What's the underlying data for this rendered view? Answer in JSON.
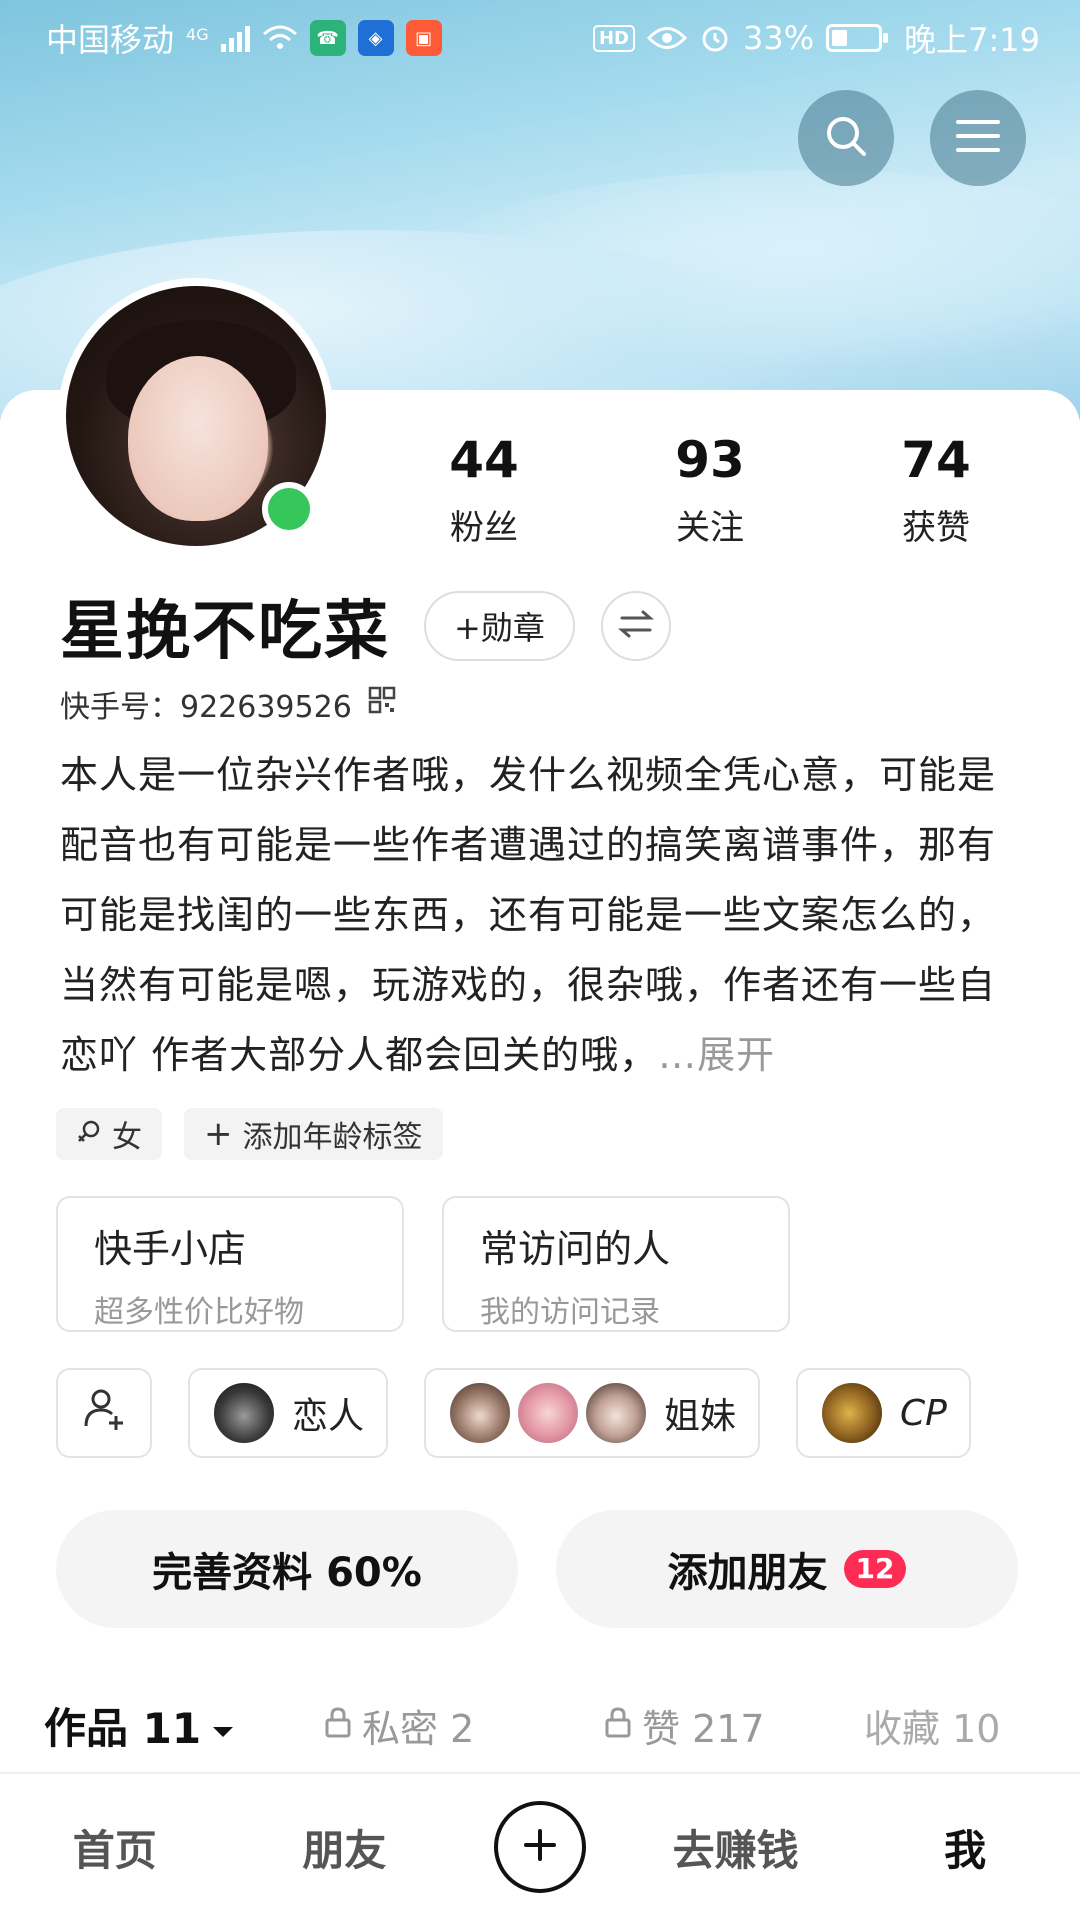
{
  "status_bar": {
    "carrier": "中国移动",
    "network": "4G",
    "battery": "33%",
    "battery_level": 0.33,
    "time": "晚上7:19",
    "hd": "HD"
  },
  "profile": {
    "nickname": "星挽不吃菜",
    "medal_label": "+勋章",
    "kuaishou_id_label": "快手号：",
    "kuaishou_id": "922639526",
    "bio": "本人是一位杂兴作者哦，发什么视频全凭心意，可能是配音也有可能是一些作者遭遇过的搞笑离谱事件，那有可能是找闺的一些东西，还有可能是一些文案怎么的，当然有可能是嗯，玩游戏的，很杂哦，作者还有一些自恋吖 作者大部分人都会回关的哦，",
    "bio_expand": "…展开",
    "online": true
  },
  "stats": [
    {
      "num": "44",
      "label": "粉丝"
    },
    {
      "num": "93",
      "label": "关注"
    },
    {
      "num": "74",
      "label": "获赞"
    }
  ],
  "tags": {
    "gender": "女",
    "add_age": "添加年龄标签"
  },
  "feature_cards": [
    {
      "title": "快手小店",
      "sub": "超多性价比好物"
    },
    {
      "title": "常访问的人",
      "sub": "我的访问记录"
    }
  ],
  "relations": {
    "lover": "恋人",
    "sisters": "姐妹",
    "cp": "CP"
  },
  "actions": {
    "complete_profile": "完善资料 60%",
    "add_friends": "添加朋友",
    "add_friends_badge": "12"
  },
  "tabs": {
    "works": "作品 11",
    "private": "私密 2",
    "likes": "赞 217",
    "favorites": "收藏 10"
  },
  "bottom_nav": {
    "home": "首页",
    "friends": "朋友",
    "earn": "去赚钱",
    "me": "我"
  }
}
